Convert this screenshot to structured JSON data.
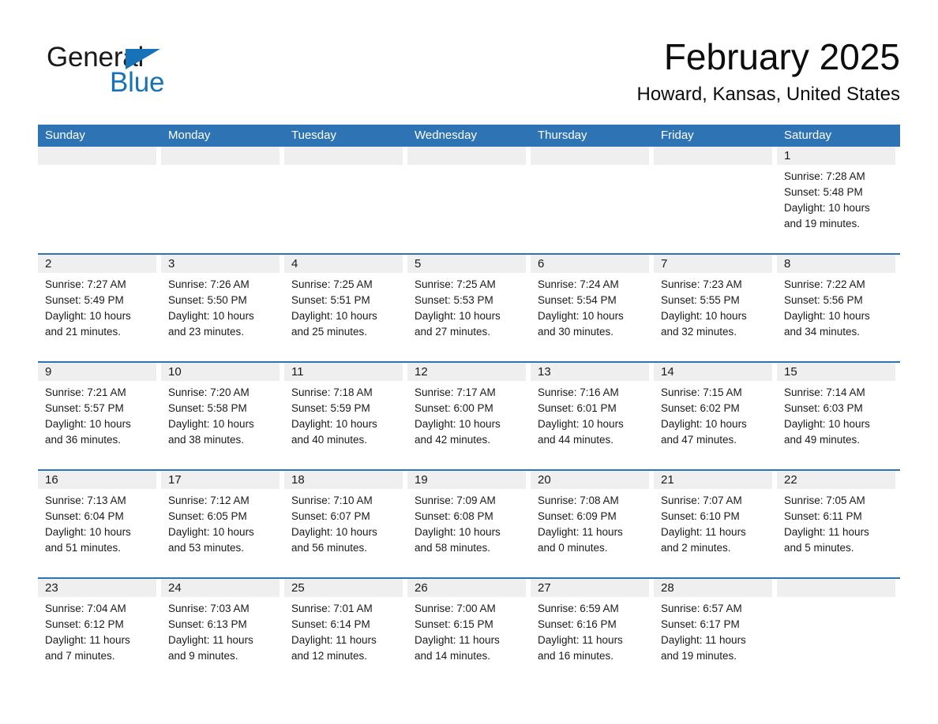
{
  "brand": {
    "name_dark": "General",
    "name_light": "Blue",
    "accent_color": "#1872b8"
  },
  "header": {
    "title": "February 2025",
    "subtitle": "Howard, Kansas, United States",
    "header_bar_color": "#2e74b5",
    "day_band_color": "#efefef"
  },
  "weekdays": [
    "Sunday",
    "Monday",
    "Tuesday",
    "Wednesday",
    "Thursday",
    "Friday",
    "Saturday"
  ],
  "weeks": [
    [
      {
        "day": "",
        "sunrise": "",
        "sunset": "",
        "daylight_line1": "",
        "daylight_line2": ""
      },
      {
        "day": "",
        "sunrise": "",
        "sunset": "",
        "daylight_line1": "",
        "daylight_line2": ""
      },
      {
        "day": "",
        "sunrise": "",
        "sunset": "",
        "daylight_line1": "",
        "daylight_line2": ""
      },
      {
        "day": "",
        "sunrise": "",
        "sunset": "",
        "daylight_line1": "",
        "daylight_line2": ""
      },
      {
        "day": "",
        "sunrise": "",
        "sunset": "",
        "daylight_line1": "",
        "daylight_line2": ""
      },
      {
        "day": "",
        "sunrise": "",
        "sunset": "",
        "daylight_line1": "",
        "daylight_line2": ""
      },
      {
        "day": "1",
        "sunrise": "Sunrise: 7:28 AM",
        "sunset": "Sunset: 5:48 PM",
        "daylight_line1": "Daylight: 10 hours",
        "daylight_line2": "and 19 minutes."
      }
    ],
    [
      {
        "day": "2",
        "sunrise": "Sunrise: 7:27 AM",
        "sunset": "Sunset: 5:49 PM",
        "daylight_line1": "Daylight: 10 hours",
        "daylight_line2": "and 21 minutes."
      },
      {
        "day": "3",
        "sunrise": "Sunrise: 7:26 AM",
        "sunset": "Sunset: 5:50 PM",
        "daylight_line1": "Daylight: 10 hours",
        "daylight_line2": "and 23 minutes."
      },
      {
        "day": "4",
        "sunrise": "Sunrise: 7:25 AM",
        "sunset": "Sunset: 5:51 PM",
        "daylight_line1": "Daylight: 10 hours",
        "daylight_line2": "and 25 minutes."
      },
      {
        "day": "5",
        "sunrise": "Sunrise: 7:25 AM",
        "sunset": "Sunset: 5:53 PM",
        "daylight_line1": "Daylight: 10 hours",
        "daylight_line2": "and 27 minutes."
      },
      {
        "day": "6",
        "sunrise": "Sunrise: 7:24 AM",
        "sunset": "Sunset: 5:54 PM",
        "daylight_line1": "Daylight: 10 hours",
        "daylight_line2": "and 30 minutes."
      },
      {
        "day": "7",
        "sunrise": "Sunrise: 7:23 AM",
        "sunset": "Sunset: 5:55 PM",
        "daylight_line1": "Daylight: 10 hours",
        "daylight_line2": "and 32 minutes."
      },
      {
        "day": "8",
        "sunrise": "Sunrise: 7:22 AM",
        "sunset": "Sunset: 5:56 PM",
        "daylight_line1": "Daylight: 10 hours",
        "daylight_line2": "and 34 minutes."
      }
    ],
    [
      {
        "day": "9",
        "sunrise": "Sunrise: 7:21 AM",
        "sunset": "Sunset: 5:57 PM",
        "daylight_line1": "Daylight: 10 hours",
        "daylight_line2": "and 36 minutes."
      },
      {
        "day": "10",
        "sunrise": "Sunrise: 7:20 AM",
        "sunset": "Sunset: 5:58 PM",
        "daylight_line1": "Daylight: 10 hours",
        "daylight_line2": "and 38 minutes."
      },
      {
        "day": "11",
        "sunrise": "Sunrise: 7:18 AM",
        "sunset": "Sunset: 5:59 PM",
        "daylight_line1": "Daylight: 10 hours",
        "daylight_line2": "and 40 minutes."
      },
      {
        "day": "12",
        "sunrise": "Sunrise: 7:17 AM",
        "sunset": "Sunset: 6:00 PM",
        "daylight_line1": "Daylight: 10 hours",
        "daylight_line2": "and 42 minutes."
      },
      {
        "day": "13",
        "sunrise": "Sunrise: 7:16 AM",
        "sunset": "Sunset: 6:01 PM",
        "daylight_line1": "Daylight: 10 hours",
        "daylight_line2": "and 44 minutes."
      },
      {
        "day": "14",
        "sunrise": "Sunrise: 7:15 AM",
        "sunset": "Sunset: 6:02 PM",
        "daylight_line1": "Daylight: 10 hours",
        "daylight_line2": "and 47 minutes."
      },
      {
        "day": "15",
        "sunrise": "Sunrise: 7:14 AM",
        "sunset": "Sunset: 6:03 PM",
        "daylight_line1": "Daylight: 10 hours",
        "daylight_line2": "and 49 minutes."
      }
    ],
    [
      {
        "day": "16",
        "sunrise": "Sunrise: 7:13 AM",
        "sunset": "Sunset: 6:04 PM",
        "daylight_line1": "Daylight: 10 hours",
        "daylight_line2": "and 51 minutes."
      },
      {
        "day": "17",
        "sunrise": "Sunrise: 7:12 AM",
        "sunset": "Sunset: 6:05 PM",
        "daylight_line1": "Daylight: 10 hours",
        "daylight_line2": "and 53 minutes."
      },
      {
        "day": "18",
        "sunrise": "Sunrise: 7:10 AM",
        "sunset": "Sunset: 6:07 PM",
        "daylight_line1": "Daylight: 10 hours",
        "daylight_line2": "and 56 minutes."
      },
      {
        "day": "19",
        "sunrise": "Sunrise: 7:09 AM",
        "sunset": "Sunset: 6:08 PM",
        "daylight_line1": "Daylight: 10 hours",
        "daylight_line2": "and 58 minutes."
      },
      {
        "day": "20",
        "sunrise": "Sunrise: 7:08 AM",
        "sunset": "Sunset: 6:09 PM",
        "daylight_line1": "Daylight: 11 hours",
        "daylight_line2": "and 0 minutes."
      },
      {
        "day": "21",
        "sunrise": "Sunrise: 7:07 AM",
        "sunset": "Sunset: 6:10 PM",
        "daylight_line1": "Daylight: 11 hours",
        "daylight_line2": "and 2 minutes."
      },
      {
        "day": "22",
        "sunrise": "Sunrise: 7:05 AM",
        "sunset": "Sunset: 6:11 PM",
        "daylight_line1": "Daylight: 11 hours",
        "daylight_line2": "and 5 minutes."
      }
    ],
    [
      {
        "day": "23",
        "sunrise": "Sunrise: 7:04 AM",
        "sunset": "Sunset: 6:12 PM",
        "daylight_line1": "Daylight: 11 hours",
        "daylight_line2": "and 7 minutes."
      },
      {
        "day": "24",
        "sunrise": "Sunrise: 7:03 AM",
        "sunset": "Sunset: 6:13 PM",
        "daylight_line1": "Daylight: 11 hours",
        "daylight_line2": "and 9 minutes."
      },
      {
        "day": "25",
        "sunrise": "Sunrise: 7:01 AM",
        "sunset": "Sunset: 6:14 PM",
        "daylight_line1": "Daylight: 11 hours",
        "daylight_line2": "and 12 minutes."
      },
      {
        "day": "26",
        "sunrise": "Sunrise: 7:00 AM",
        "sunset": "Sunset: 6:15 PM",
        "daylight_line1": "Daylight: 11 hours",
        "daylight_line2": "and 14 minutes."
      },
      {
        "day": "27",
        "sunrise": "Sunrise: 6:59 AM",
        "sunset": "Sunset: 6:16 PM",
        "daylight_line1": "Daylight: 11 hours",
        "daylight_line2": "and 16 minutes."
      },
      {
        "day": "28",
        "sunrise": "Sunrise: 6:57 AM",
        "sunset": "Sunset: 6:17 PM",
        "daylight_line1": "Daylight: 11 hours",
        "daylight_line2": "and 19 minutes."
      },
      {
        "day": "",
        "sunrise": "",
        "sunset": "",
        "daylight_line1": "",
        "daylight_line2": ""
      }
    ]
  ]
}
